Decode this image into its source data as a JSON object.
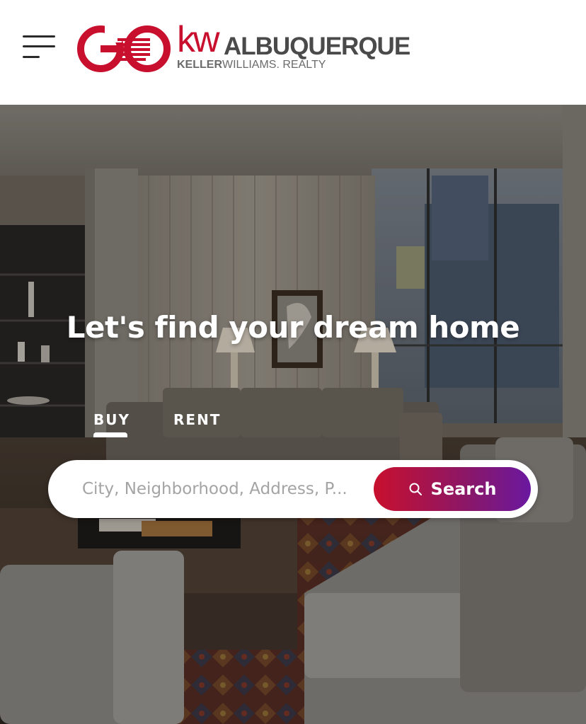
{
  "header": {
    "logo": {
      "monogram": "GO",
      "kw": "kw",
      "city": "ALBUQUERQUE",
      "brand_bold": "KELLER",
      "brand_rest": "WILLIAMS. REALTY"
    },
    "menu_icon": "hamburger-menu-icon"
  },
  "hero": {
    "title": "Let's find your dream home",
    "tabs": [
      {
        "label": "BUY",
        "active": true
      },
      {
        "label": "RENT",
        "active": false
      }
    ],
    "search": {
      "placeholder": "City, Neighborhood, Address, P...",
      "value": "",
      "button_label": "Search",
      "button_icon": "search-icon"
    }
  },
  "colors": {
    "brand_red": "#c8102e",
    "brand_purple": "#6a18a0",
    "logo_gray": "#4a4a4a"
  }
}
